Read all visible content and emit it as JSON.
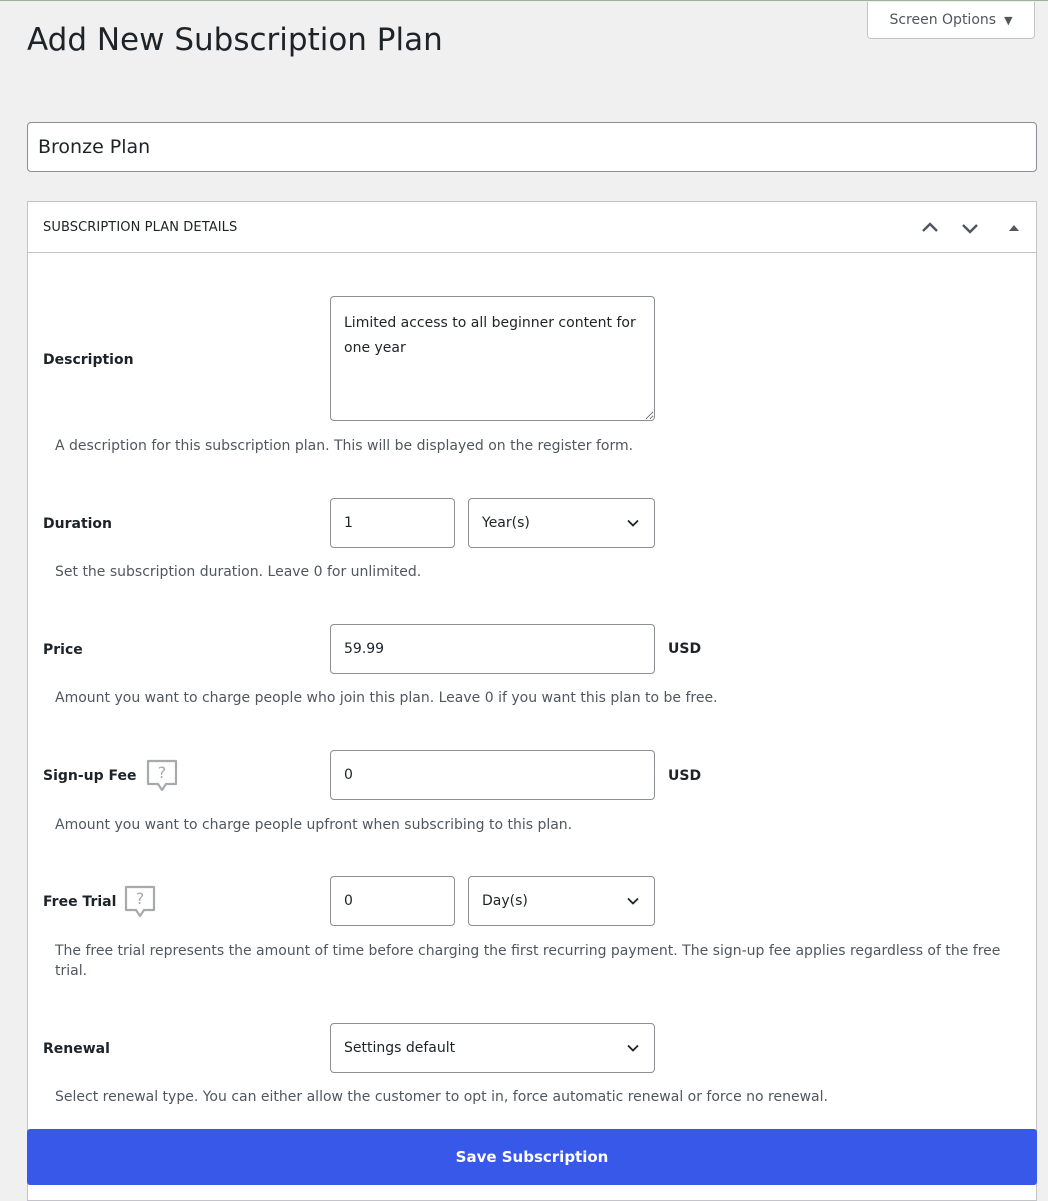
{
  "screen_options": {
    "label": "Screen Options",
    "icon": "triangle-down-icon"
  },
  "page_title": "Add New Subscription Plan",
  "plan_name": {
    "value": "Bronze Plan"
  },
  "panel": {
    "title": "SUBSCRIPTION PLAN DETAILS",
    "controls": [
      "chevron-up-icon",
      "chevron-down-icon",
      "triangle-up-icon"
    ]
  },
  "fields": {
    "description": {
      "label": "Description",
      "value": "Limited access to all beginner content for one year",
      "help": "A description for this subscription plan. This will be displayed on the register form."
    },
    "duration": {
      "label": "Duration",
      "value": "1",
      "unit": "Year(s)",
      "help": "Set the subscription duration. Leave 0 for unlimited."
    },
    "price": {
      "label": "Price",
      "value": "59.99",
      "currency": "USD",
      "help": "Amount you want to charge people who join this plan. Leave 0 if you want this plan to be free."
    },
    "signup_fee": {
      "label": "Sign-up Fee",
      "value": "0",
      "currency": "USD",
      "help": "Amount you want to charge people upfront when subscribing to this plan."
    },
    "free_trial": {
      "label": "Free Trial",
      "value": "0",
      "unit": "Day(s)",
      "help": "The free trial represents the amount of time before charging the first recurring payment. The sign-up fee applies regardless of the free trial."
    },
    "renewal": {
      "label": "Renewal",
      "value": "Settings default",
      "help": "Select renewal type. You can either allow the customer to opt in, force automatic renewal or force no renewal."
    }
  },
  "save_button": "Save Subscription",
  "colors": {
    "primary": "#3858e9",
    "border": "#8c8f94",
    "background": "#f0f0f1"
  }
}
